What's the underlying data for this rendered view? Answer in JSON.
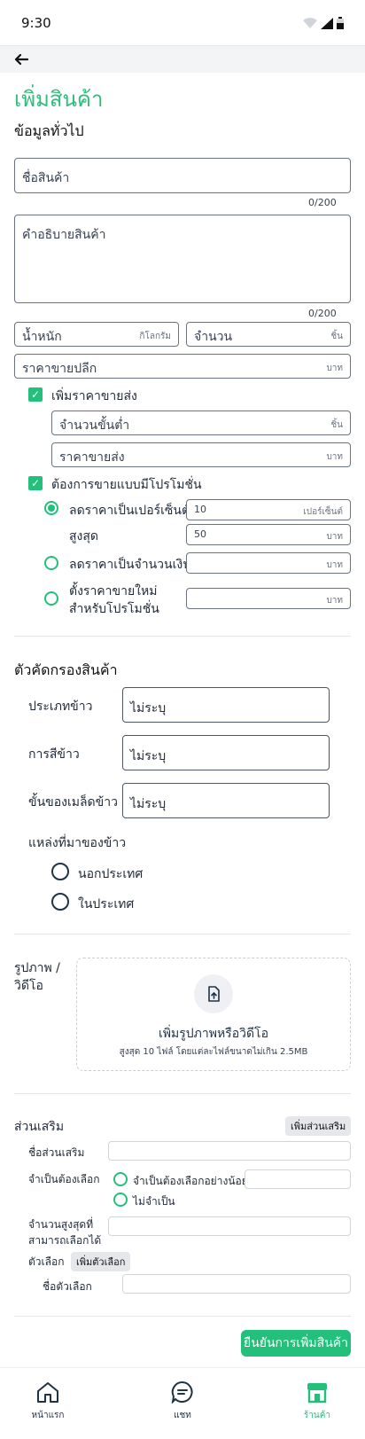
{
  "status": {
    "time": "9:30"
  },
  "page": {
    "title": "เพิ่มสินค้า"
  },
  "general": {
    "title": "ข้อมูลทั่วไป",
    "name_ph": "ชื่อสินค้า",
    "name_count": "0/200",
    "desc_ph": "คำอธิบายสินค้า",
    "desc_count": "0/200",
    "weight_ph": "น้ำหนัก",
    "weight_unit": "กิโลกรัม",
    "qty_ph": "จำนวน",
    "qty_unit": "ชิ้น",
    "retail_ph": "ราคาขายปลีก",
    "retail_unit": "บาท",
    "wholesale_check": "เพิ่มราคาขายส่ง",
    "min_qty_ph": "จำนวนขั้นต่ำ",
    "min_qty_unit": "ชิ้น",
    "wholesale_ph": "ราคาขายส่ง",
    "wholesale_unit": "บาท",
    "promo_check": "ต้องการขายแบบมีโปรโมชั่น",
    "promo_percent_label": "ลดราคาเป็นเปอร์เซ็นต์",
    "promo_percent_value": "10",
    "promo_percent_unit": "เปอร์เซ็นต์",
    "promo_max_label": "สูงสุด",
    "promo_max_value": "50",
    "promo_max_unit": "บาท",
    "promo_amount_label": "ลดราคาเป็นจำนวนเงิน",
    "promo_amount_unit": "บาท",
    "promo_newprice_label1": "ตั้งราคาขายใหม่",
    "promo_newprice_label2": "สำหรับโปรโมชั่น",
    "promo_newprice_unit": "บาท"
  },
  "filter": {
    "title": "ตัวคัดกรองสินค้า",
    "rice_type_label": "ประเภทข้าว",
    "rice_type_value": "ไม่ระบุ",
    "milling_label": "การสีข้าว",
    "milling_value": "ไม่ระบุ",
    "grain_label": "ขั้นของเมล็ดข้าว",
    "grain_value": "ไม่ระบุ",
    "origin_label": "แหล่งที่มาของข้าว",
    "origin_opt1": "นอกประเทศ",
    "origin_opt2": "ในประเทศ"
  },
  "media": {
    "label1": "รูปภาพ /",
    "label2": "วิดีโอ",
    "upload_title": "เพิ่มรูปภาพหรือวิดีโอ",
    "upload_hint": "สูงสุด 10 ไฟล์ โดยแต่ละไฟล์ขนาดไม่เกิน 2.5MB"
  },
  "addon": {
    "title": "ส่วนเสริม",
    "add_button": "เพิ่มส่วนเสริม",
    "name_label": "ชื่อส่วนเสริม",
    "required_label": "จำเป็นต้องเลือก",
    "required_opt1": "จำเป็นต้องเลือกอย่างน้อย",
    "required_opt2": "ไม่จำเป็น",
    "max_label1": "จำนวนสูงสุดที่",
    "max_label2": "สามารถเลือกได้",
    "options_label": "ตัวเลือก",
    "add_option": "เพิ่มตัวเลือก",
    "option_name_label": "ชื่อตัวเลือก"
  },
  "confirm_button": "ยืนยันการเพิ่มสินค้า",
  "nav": {
    "home": "หน้าแรก",
    "chat": "แชท",
    "shop": "ร้านค้า"
  },
  "colors": {
    "accent": "#22c07a",
    "navy": "#1f3347"
  }
}
